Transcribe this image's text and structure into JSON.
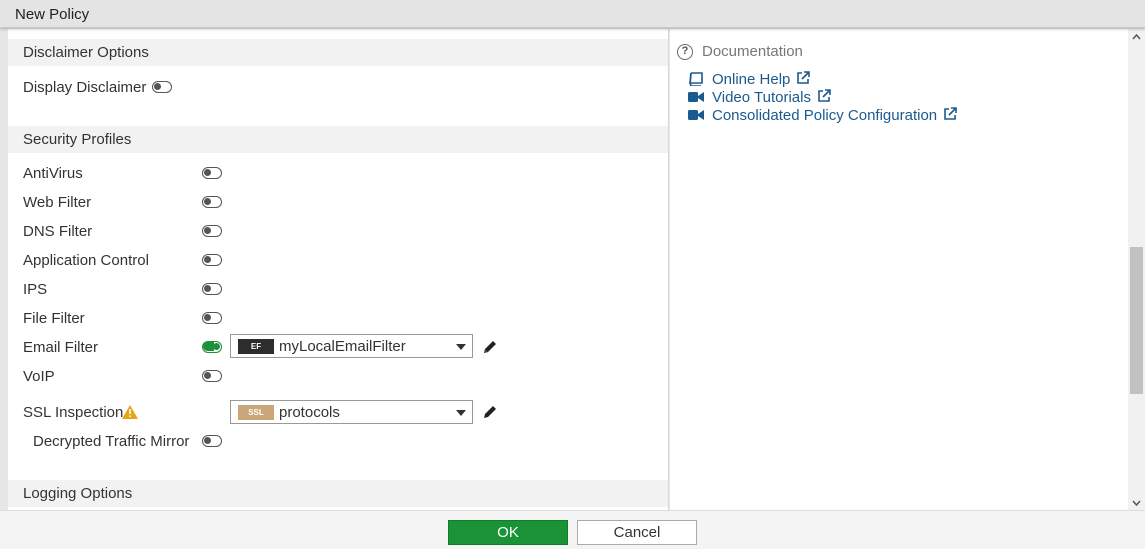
{
  "window": {
    "title": "New Policy"
  },
  "disclaimer": {
    "header": "Disclaimer Options",
    "display_label": "Display Disclaimer",
    "display_enabled": false
  },
  "security": {
    "header": "Security Profiles",
    "profiles": [
      {
        "label": "AntiVirus",
        "enabled": false
      },
      {
        "label": "Web Filter",
        "enabled": false
      },
      {
        "label": "DNS Filter",
        "enabled": false
      },
      {
        "label": "Application Control",
        "enabled": false
      },
      {
        "label": "IPS",
        "enabled": false
      },
      {
        "label": "File Filter",
        "enabled": false
      },
      {
        "label": "Email Filter",
        "enabled": true,
        "badge": "EF",
        "badge_color": "#2d2d2d",
        "selected": "myLocalEmailFilter"
      },
      {
        "label": "VoIP",
        "enabled": false
      }
    ],
    "ssl": {
      "label": "SSL Inspection",
      "badge": "SSL",
      "badge_color": "#c9a77a",
      "selected": "protocols",
      "warning_icon": "warning-icon"
    },
    "decrypted": {
      "label": "Decrypted Traffic Mirror",
      "enabled": false
    }
  },
  "logging": {
    "header": "Logging Options"
  },
  "documentation": {
    "title": "Documentation",
    "links": [
      {
        "label": "Online Help",
        "icon": "book-icon"
      },
      {
        "label": "Video Tutorials",
        "icon": "video-icon"
      },
      {
        "label": "Consolidated Policy Configuration",
        "icon": "video-icon"
      }
    ]
  },
  "footer": {
    "ok_label": "OK",
    "cancel_label": "Cancel"
  },
  "colors": {
    "accent_green": "#1a9236",
    "link_blue": "#1b5a8f"
  }
}
